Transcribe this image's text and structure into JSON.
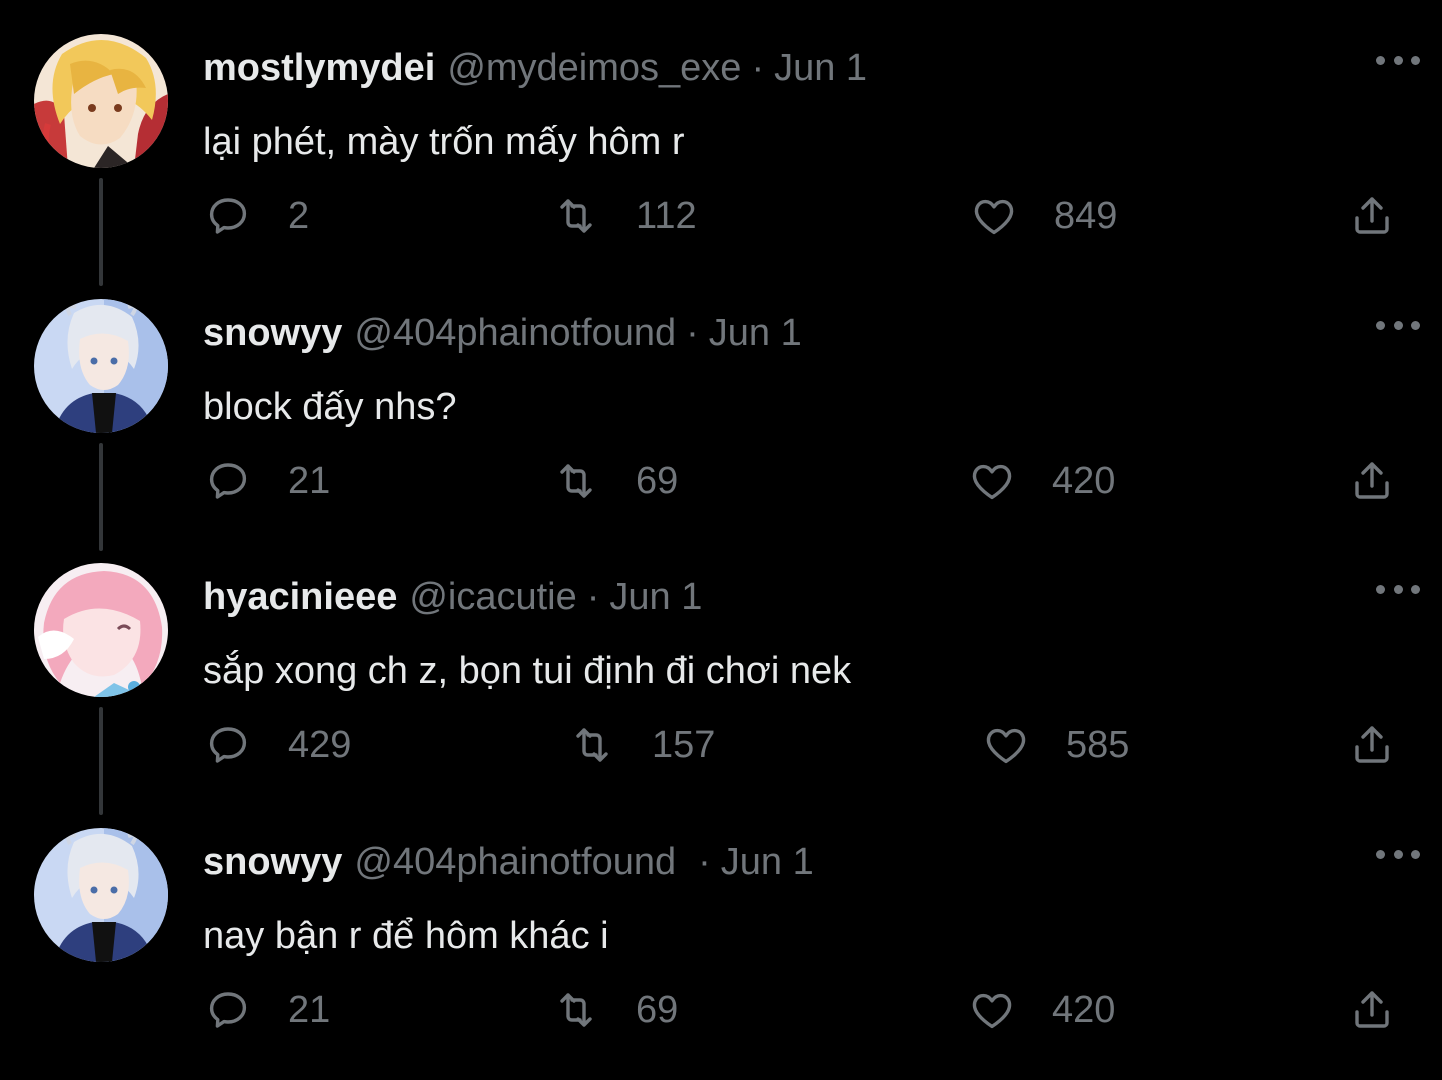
{
  "colors": {
    "background": "#000000",
    "primary_text": "#e7e9ea",
    "secondary_text": "#71767b",
    "thread_line": "#333639"
  },
  "tweets": [
    {
      "display_name": "mostlymydei",
      "handle": "@mydeimos_exe",
      "separator": "·",
      "date": "Jun 1",
      "text": "lại phét, mày trốn mấy hôm r",
      "replies": "2",
      "retweets": "112",
      "likes": "849",
      "avatar": "blonde-red-anime-avatar"
    },
    {
      "display_name": "snowyy",
      "handle": "@404phainotfound",
      "separator": "·",
      "date": "Jun 1",
      "text": "block đấy nhs?",
      "replies": "21",
      "retweets": "69",
      "likes": "420",
      "avatar": "silver-hair-blue-coat-avatar"
    },
    {
      "display_name": "hyacinieee",
      "handle": "@icacutie",
      "separator": "·",
      "date": "Jun 1",
      "text": "sắp xong ch z, bọn tui định đi chơi nek",
      "replies": "429",
      "retweets": "157",
      "likes": "585",
      "avatar": "pink-hair-chibi-avatar"
    },
    {
      "display_name": "snowyy",
      "handle": "@404phainotfound",
      "separator": "·",
      "date": "Jun 1",
      "text": "nay bận r để hôm khác i",
      "replies": "21",
      "retweets": "69",
      "likes": "420",
      "avatar": "silver-hair-blue-coat-avatar"
    }
  ],
  "icons": {
    "reply": "reply-icon",
    "retweet": "retweet-icon",
    "like": "like-icon",
    "share": "share-icon",
    "more": "more-icon"
  }
}
